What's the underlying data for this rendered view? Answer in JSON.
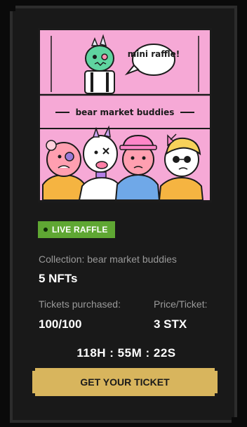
{
  "artwork": {
    "speech_bubble": "mini raffle!",
    "banner_text": "bear market buddies"
  },
  "status": {
    "label": "LIVE RAFFLE",
    "color": "#5fa733"
  },
  "collection": {
    "label": "Collection: bear market buddies",
    "count": "5 NFTs"
  },
  "tickets": {
    "label": "Tickets purchased:",
    "value": "100/100"
  },
  "price": {
    "label": "Price/Ticket:",
    "value": "3 STX"
  },
  "countdown": "118H : 55M : 22S",
  "cta": {
    "label": "GET YOUR TICKET",
    "color": "#d8b55d"
  }
}
